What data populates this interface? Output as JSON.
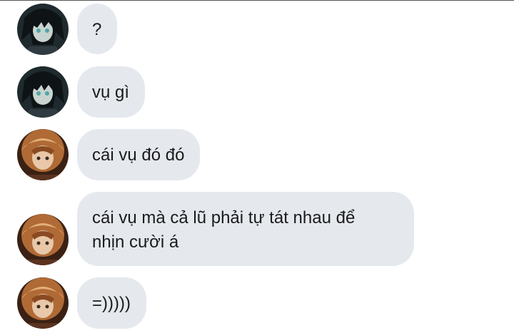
{
  "messages": [
    {
      "sender": "boy",
      "text": "?"
    },
    {
      "sender": "boy",
      "text": "vụ gì"
    },
    {
      "sender": "girl",
      "text": "cái vụ đó đó"
    },
    {
      "sender": "girl",
      "text": "cái vụ mà cả lũ phải tự tát nhau để\nnhịn cười á"
    },
    {
      "sender": "girl",
      "text": "=)))))"
    }
  ],
  "colors": {
    "bubble": "#e5e9ee",
    "text": "#1b1b1b",
    "boy_avatar": "#2b3a3f",
    "girl_avatar": "#7a4a28"
  }
}
